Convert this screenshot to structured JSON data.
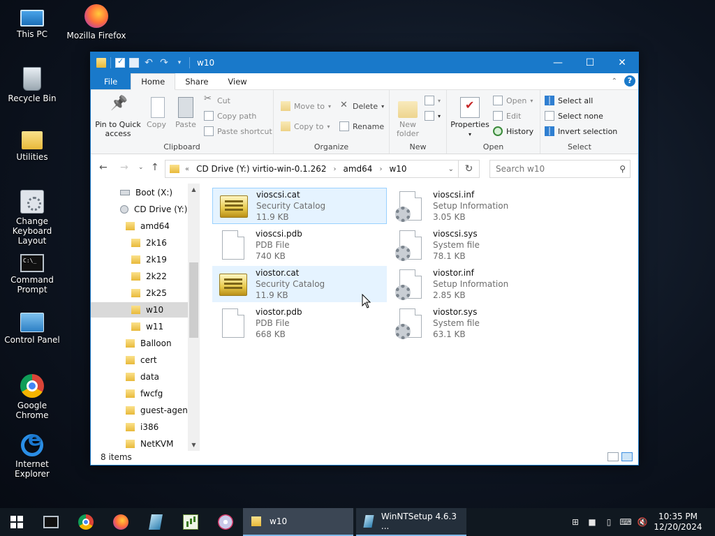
{
  "desktop": {
    "icons": [
      {
        "label": "This PC"
      },
      {
        "label": "Mozilla Firefox"
      },
      {
        "label": "Recycle Bin"
      },
      {
        "label": "Utilities"
      },
      {
        "label": "Change Keyboard Layout"
      },
      {
        "label": "Command Prompt"
      },
      {
        "label": "Control Panel"
      },
      {
        "label": "Google Chrome"
      },
      {
        "label": "Internet Explorer"
      }
    ]
  },
  "window": {
    "title": "w10",
    "controls": {
      "minimize": "—",
      "maximize": "☐",
      "close": "✕"
    },
    "tabs": {
      "file": "File",
      "home": "Home",
      "share": "Share",
      "view": "View"
    },
    "help": "?"
  },
  "ribbon": {
    "clipboard": {
      "label": "Clipboard",
      "pin": "Pin to Quick access",
      "copy": "Copy",
      "paste": "Paste",
      "cut": "Cut",
      "copy_path": "Copy path",
      "paste_shortcut": "Paste shortcut"
    },
    "organize": {
      "label": "Organize",
      "move_to": "Move to",
      "copy_to": "Copy to",
      "delete": "Delete",
      "rename": "Rename"
    },
    "new": {
      "label": "New",
      "new_folder": "New folder"
    },
    "open": {
      "label": "Open",
      "properties": "Properties",
      "open": "Open",
      "edit": "Edit",
      "history": "History"
    },
    "select": {
      "label": "Select",
      "select_all": "Select all",
      "select_none": "Select none",
      "invert": "Invert selection"
    }
  },
  "address": {
    "prefix": "«",
    "crumbs": [
      "CD Drive (Y:) virtio-win-0.1.262",
      "amd64",
      "w10"
    ],
    "search_placeholder": "Search w10"
  },
  "navpane": {
    "items": [
      {
        "label": "Boot (X:)"
      },
      {
        "label": "CD Drive (Y:) vi"
      },
      {
        "label": "amd64"
      },
      {
        "label": "2k16"
      },
      {
        "label": "2k19"
      },
      {
        "label": "2k22"
      },
      {
        "label": "2k25"
      },
      {
        "label": "w10"
      },
      {
        "label": "w11"
      },
      {
        "label": "Balloon"
      },
      {
        "label": "cert"
      },
      {
        "label": "data"
      },
      {
        "label": "fwcfg"
      },
      {
        "label": "guest-agent"
      },
      {
        "label": "i386"
      },
      {
        "label": "NetKVM"
      }
    ]
  },
  "files": [
    {
      "name": "vioscsi.cat",
      "type": "Security Catalog",
      "size": "11.9 KB",
      "icon": "catalog-icon"
    },
    {
      "name": "vioscsi.inf",
      "type": "Setup Information",
      "size": "3.05 KB",
      "icon": "setup-info-icon"
    },
    {
      "name": "vioscsi.pdb",
      "type": "PDB File",
      "size": "740 KB",
      "icon": "blank-file-icon"
    },
    {
      "name": "vioscsi.sys",
      "type": "System file",
      "size": "78.1 KB",
      "icon": "system-file-icon"
    },
    {
      "name": "viostor.cat",
      "type": "Security Catalog",
      "size": "11.9 KB",
      "icon": "catalog-icon"
    },
    {
      "name": "viostor.inf",
      "type": "Setup Information",
      "size": "2.85 KB",
      "icon": "setup-info-icon"
    },
    {
      "name": "viostor.pdb",
      "type": "PDB File",
      "size": "668 KB",
      "icon": "blank-file-icon"
    },
    {
      "name": "viostor.sys",
      "type": "System file",
      "size": "63.1 KB",
      "icon": "system-file-icon"
    }
  ],
  "status": {
    "item_count": "8 items"
  },
  "taskbar": {
    "tasks": [
      {
        "label": "w10"
      },
      {
        "label": "WinNTSetup 4.6.3   ..."
      }
    ],
    "clock": {
      "time": "10:35 PM",
      "date": "12/20/2024"
    }
  },
  "colors": {
    "accent": "#1979ca",
    "selection": "#e5f3ff",
    "folder": "#e8b93a"
  }
}
